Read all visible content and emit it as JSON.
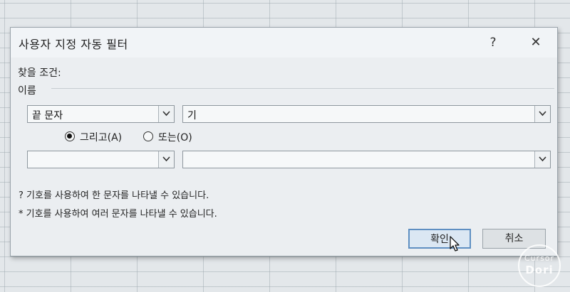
{
  "dialog": {
    "title": "사용자 지정 자동 필터",
    "help": "?",
    "close": "✕",
    "criteria_label": "찾을 조건:",
    "field_name": "이름",
    "row1": {
      "operator": "끝 문자",
      "value": "기"
    },
    "logic": {
      "and_label": "그리고(A)",
      "or_label": "또는(O)",
      "selected": "and"
    },
    "row2": {
      "operator": "",
      "value": ""
    },
    "hint1": "? 기호를 사용하여 한 문자를 나타낼 수 있습니다.",
    "hint2": "* 기호를 사용하여 여러 문자를 나타낼 수 있습니다.",
    "ok_label": "확인",
    "cancel_label": "취소"
  },
  "watermark": {
    "line1": "Cursor",
    "line2": "Dori"
  }
}
